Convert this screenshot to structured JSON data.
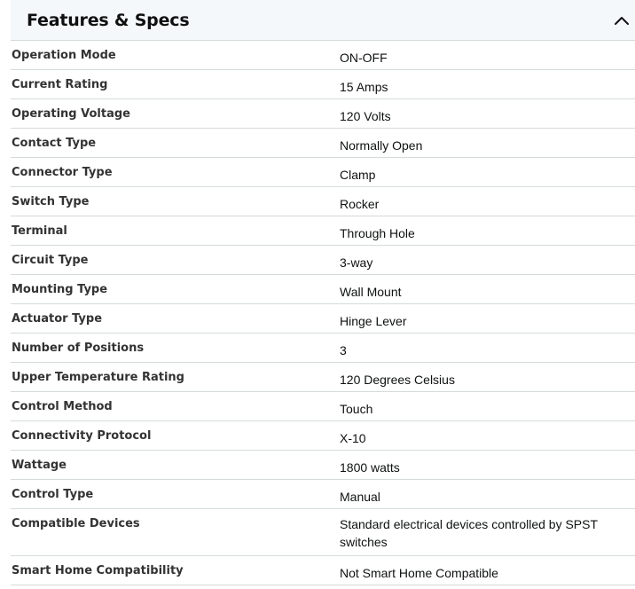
{
  "section": {
    "title": "Features & Specs",
    "toggle_icon": "chevron-up-icon",
    "expanded": true
  },
  "specs": [
    {
      "label": "Operation Mode",
      "value": "ON-OFF"
    },
    {
      "label": "Current Rating",
      "value": "15 Amps"
    },
    {
      "label": "Operating Voltage",
      "value": "120 Volts"
    },
    {
      "label": "Contact Type",
      "value": "Normally Open"
    },
    {
      "label": "Connector Type",
      "value": "Clamp"
    },
    {
      "label": "Switch Type",
      "value": "Rocker"
    },
    {
      "label": "Terminal",
      "value": "Through Hole"
    },
    {
      "label": "Circuit Type",
      "value": "3-way"
    },
    {
      "label": "Mounting Type",
      "value": "Wall Mount"
    },
    {
      "label": "Actuator Type",
      "value": "Hinge Lever"
    },
    {
      "label": "Number of Positions",
      "value": "3"
    },
    {
      "label": "Upper Temperature Rating",
      "value": "120 Degrees Celsius"
    },
    {
      "label": "Control Method",
      "value": "Touch"
    },
    {
      "label": "Connectivity Protocol",
      "value": "X-10"
    },
    {
      "label": "Wattage",
      "value": "1800 watts"
    },
    {
      "label": "Control Type",
      "value": "Manual"
    },
    {
      "label": "Compatible Devices",
      "value": "Standard electrical devices controlled by SPST switches"
    },
    {
      "label": "Smart Home Compatibility",
      "value": "Not Smart Home Compatible"
    }
  ],
  "colors": {
    "header_bg": "#f5f8fa",
    "divider": "#d5dbdb",
    "label_text": "#333333",
    "value_text": "#0f1111"
  }
}
